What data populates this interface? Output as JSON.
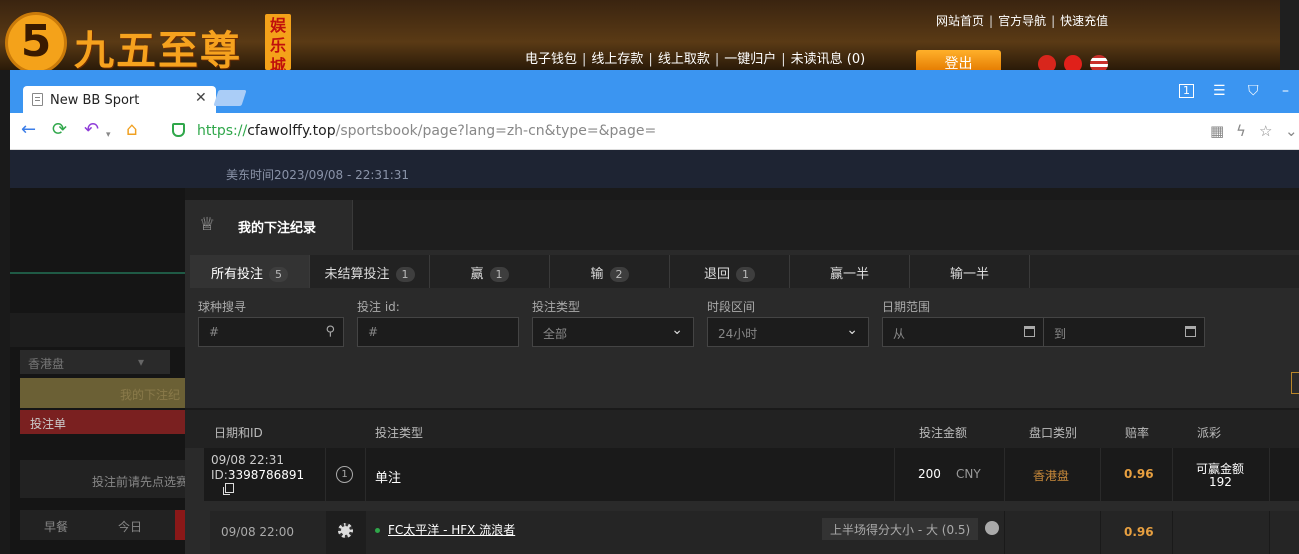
{
  "site": {
    "logo_digit": "5",
    "logo_text": "九五至尊",
    "logo_badge": "娱乐城",
    "top_links": [
      "网站首页",
      "官方导航",
      "快速充值"
    ],
    "nav_links": [
      "电子钱包",
      "线上存款",
      "线上取款",
      "一键归户",
      "未读讯息 (0)"
    ],
    "logout_label": "登出"
  },
  "browser": {
    "tab_title": "New BB Sport",
    "url_scheme": "https://",
    "url_host": "cfawolffy.top",
    "url_path": "/sportsbook/page?lang=zh-cn&type=&page="
  },
  "sportsbook": {
    "time_label": "美东时间2023/09/08 - 22:31:31",
    "left_panel": {
      "odds_select": "香港盘",
      "note": "我的下注纪",
      "slip": "投注单",
      "hint": "投注前请先点选赛",
      "tabs": [
        "早餐",
        "今日"
      ]
    },
    "modal": {
      "title": "我的下注纪录",
      "tabs": [
        {
          "label": "所有投注",
          "count": "5"
        },
        {
          "label": "未结算投注",
          "count": "1"
        },
        {
          "label": "赢",
          "count": "1"
        },
        {
          "label": "输",
          "count": "2"
        },
        {
          "label": "退回",
          "count": "1"
        },
        {
          "label": "赢一半",
          "count": ""
        },
        {
          "label": "输一半",
          "count": ""
        }
      ],
      "filters": {
        "sport_label": "球种搜寻",
        "sport_placeholder": "#",
        "betid_label": "投注 id:",
        "betid_placeholder": "#",
        "bettype_label": "投注类型",
        "bettype_value": "全部",
        "period_label": "时段区间",
        "period_value": "24小时",
        "date_label": "日期范围",
        "date_from": "从",
        "date_to": "到"
      },
      "columns": [
        "日期和ID",
        "投注类型",
        "投注金额",
        "盘口类别",
        "赔率",
        "派彩"
      ],
      "bet": {
        "date": "09/08 22:31",
        "id_prefix": "ID:",
        "id": "3398786891",
        "type_num": "1",
        "type": "单注",
        "amount": "200",
        "currency": "CNY",
        "market": "香港盘",
        "odds": "0.96",
        "payout_label": "可赢金额",
        "payout": "192"
      },
      "selection": {
        "time": "09/08 22:00",
        "match": "FC太平洋 - HFX 流浪者",
        "market": "上半场得分大小 - 大 (0.5)",
        "odds": "0.96"
      }
    }
  },
  "colors": {
    "accent": "#f4a21a",
    "tabbar": "#3b95f1",
    "odds": "#e8a040"
  }
}
